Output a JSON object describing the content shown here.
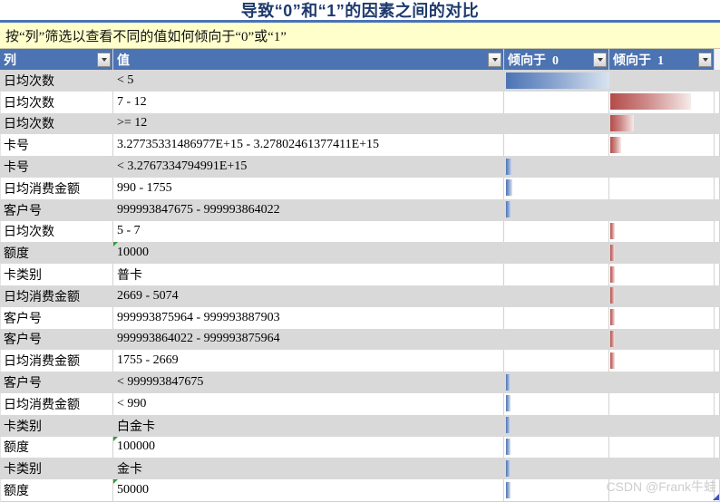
{
  "title": "导致“0”和“1”的因素之间的对比",
  "subtitle": "按“列”筛选以查看不同的值如何倾向于“0”或“1”",
  "columns": [
    {
      "label": "列"
    },
    {
      "label": "值"
    },
    {
      "label": "倾向于  0"
    },
    {
      "label": "倾向于  1"
    }
  ],
  "rows": [
    {
      "col": "日均次数",
      "value": "< 5",
      "favor": "0",
      "pct": 100,
      "flag": false
    },
    {
      "col": "日均次数",
      "value": "7 - 12",
      "favor": "1",
      "pct": 77,
      "flag": false
    },
    {
      "col": "日均次数",
      "value": ">= 12",
      "favor": "1",
      "pct": 22,
      "flag": false
    },
    {
      "col": "卡号",
      "value": "3.27735331486977E+15 - 3.27802461377411E+15",
      "favor": "1",
      "pct": 10,
      "flag": false
    },
    {
      "col": "卡号",
      "value": "< 3.2767334794991E+15",
      "favor": "0",
      "pct": 6,
      "flag": false
    },
    {
      "col": "日均消费金额",
      "value": "990 - 1755",
      "favor": "0",
      "pct": 6,
      "flag": false
    },
    {
      "col": "客户号",
      "value": "999993847675 - 999993864022",
      "favor": "0",
      "pct": 5,
      "flag": false
    },
    {
      "col": "日均次数",
      "value": "5 - 7",
      "favor": "1",
      "pct": 4,
      "flag": false
    },
    {
      "col": "额度",
      "value": "10000",
      "favor": "1",
      "pct": 4,
      "flag": true
    },
    {
      "col": "卡类别",
      "value": "普卡",
      "favor": "1",
      "pct": 4,
      "flag": false
    },
    {
      "col": "日均消费金额",
      "value": "2669 - 5074",
      "favor": "1",
      "pct": 4,
      "flag": false
    },
    {
      "col": "客户号",
      "value": "999993875964 - 999993887903",
      "favor": "1",
      "pct": 4,
      "flag": false
    },
    {
      "col": "客户号",
      "value": "999993864022 - 999993875964",
      "favor": "1",
      "pct": 4,
      "flag": false
    },
    {
      "col": "日均消费金额",
      "value": "1755 - 2669",
      "favor": "1",
      "pct": 4,
      "flag": false
    },
    {
      "col": "客户号",
      "value": "< 999993847675",
      "favor": "0",
      "pct": 4,
      "flag": false
    },
    {
      "col": "日均消费金额",
      "value": "< 990",
      "favor": "0",
      "pct": 4,
      "flag": false
    },
    {
      "col": "卡类别",
      "value": "白金卡",
      "favor": "0",
      "pct": 4,
      "flag": false
    },
    {
      "col": "额度",
      "value": "100000",
      "favor": "0",
      "pct": 4,
      "flag": true
    },
    {
      "col": "卡类别",
      "value": "金卡",
      "favor": "0",
      "pct": 4,
      "flag": false
    },
    {
      "col": "额度",
      "value": "50000",
      "favor": "0",
      "pct": 4,
      "flag": true
    }
  ],
  "watermark": "CSDN @Frank牛蛙",
  "colors": {
    "header_bg": "#4c73b2",
    "title_text": "#1e3a6d",
    "title_underline": "#4a72b8",
    "subtitle_bg": "#ffffcc",
    "row_alt_bg": "#d9d9d9",
    "favor0_bar": "#4b74b4",
    "favor1_bar": "#b44b48",
    "error_flag": "#2da12d",
    "watermark_text": "#cdcdcd"
  }
}
